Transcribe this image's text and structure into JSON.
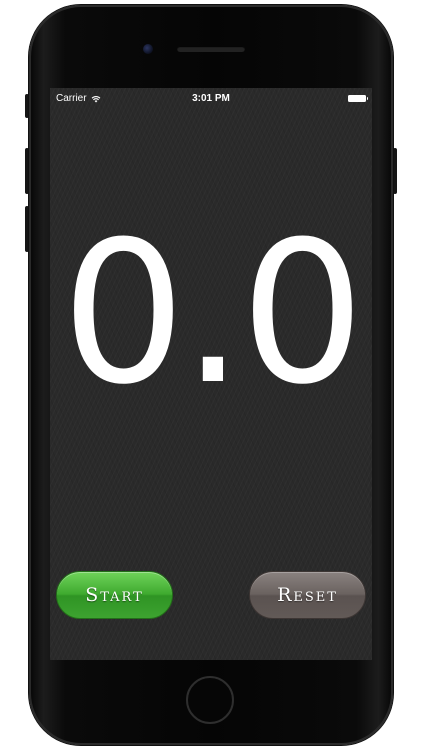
{
  "status_bar": {
    "carrier": "Carrier",
    "time": "3:01 PM",
    "wifi_icon": "wifi-icon",
    "battery_icon": "battery-icon"
  },
  "timer": {
    "value": "0.0"
  },
  "controls": {
    "start_label": "Start",
    "reset_label": "Reset"
  },
  "colors": {
    "start_button": "#3faa2f",
    "reset_button": "#6a625f",
    "screen_background": "#2a2a2a",
    "timer_text": "#ffffff"
  }
}
